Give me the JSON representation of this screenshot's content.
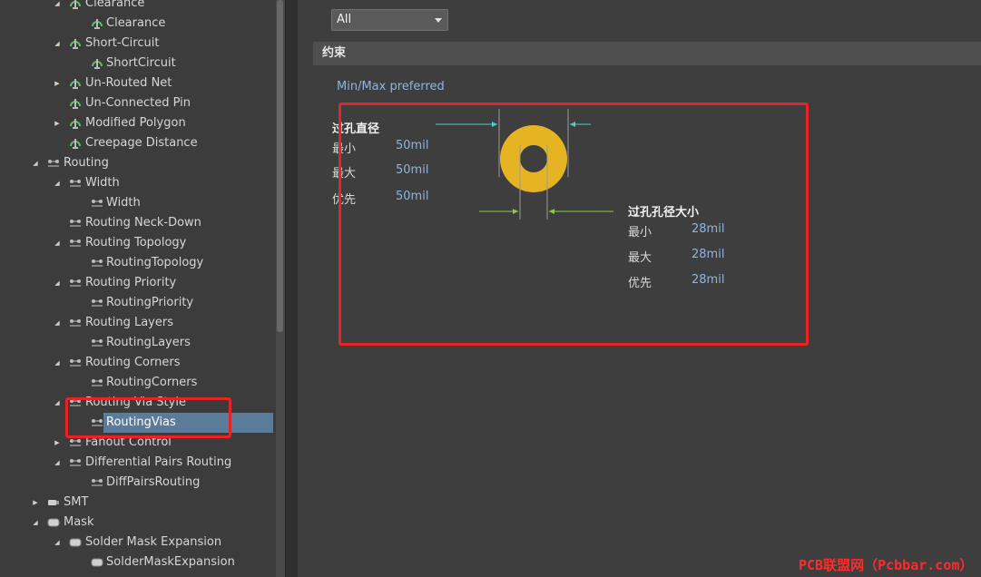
{
  "tree": {
    "items": [
      {
        "label": "Clearance",
        "level": 2,
        "twisty": "expanded",
        "icon": "drc-rule-icon"
      },
      {
        "label": "Clearance",
        "level": 3,
        "twisty": "",
        "icon": "drc-rule-icon"
      },
      {
        "label": "Short-Circuit",
        "level": 2,
        "twisty": "expanded",
        "icon": "drc-rule-icon"
      },
      {
        "label": "ShortCircuit",
        "level": 3,
        "twisty": "",
        "icon": "drc-rule-icon"
      },
      {
        "label": "Un-Routed Net",
        "level": 2,
        "twisty": "collapsed",
        "icon": "drc-rule-icon"
      },
      {
        "label": "Un-Connected Pin",
        "level": 2,
        "twisty": "",
        "icon": "drc-rule-icon"
      },
      {
        "label": "Modified Polygon",
        "level": 2,
        "twisty": "collapsed",
        "icon": "drc-rule-icon"
      },
      {
        "label": "Creepage Distance",
        "level": 2,
        "twisty": "",
        "icon": "drc-rule-icon"
      },
      {
        "label": "Routing",
        "level": 1,
        "twisty": "expanded",
        "icon": "routing-icon"
      },
      {
        "label": "Width",
        "level": 2,
        "twisty": "expanded",
        "icon": "routing-icon"
      },
      {
        "label": "Width",
        "level": 3,
        "twisty": "",
        "icon": "routing-icon"
      },
      {
        "label": "Routing Neck-Down",
        "level": 2,
        "twisty": "",
        "icon": "routing-icon"
      },
      {
        "label": "Routing Topology",
        "level": 2,
        "twisty": "expanded",
        "icon": "routing-icon"
      },
      {
        "label": "RoutingTopology",
        "level": 3,
        "twisty": "",
        "icon": "routing-icon"
      },
      {
        "label": "Routing Priority",
        "level": 2,
        "twisty": "expanded",
        "icon": "routing-icon"
      },
      {
        "label": "RoutingPriority",
        "level": 3,
        "twisty": "",
        "icon": "routing-icon"
      },
      {
        "label": "Routing Layers",
        "level": 2,
        "twisty": "expanded",
        "icon": "routing-icon"
      },
      {
        "label": "RoutingLayers",
        "level": 3,
        "twisty": "",
        "icon": "routing-icon"
      },
      {
        "label": "Routing Corners",
        "level": 2,
        "twisty": "expanded",
        "icon": "routing-icon"
      },
      {
        "label": "RoutingCorners",
        "level": 3,
        "twisty": "",
        "icon": "routing-icon"
      },
      {
        "label": "Routing Via Style",
        "level": 2,
        "twisty": "expanded",
        "icon": "routing-icon"
      },
      {
        "label": "RoutingVias",
        "level": 3,
        "twisty": "",
        "icon": "routing-icon",
        "selected": true
      },
      {
        "label": "Fanout Control",
        "level": 2,
        "twisty": "collapsed",
        "icon": "routing-icon"
      },
      {
        "label": "Differential Pairs Routing",
        "level": 2,
        "twisty": "expanded",
        "icon": "routing-icon"
      },
      {
        "label": "DiffPairsRouting",
        "level": 3,
        "twisty": "",
        "icon": "routing-icon"
      },
      {
        "label": "SMT",
        "level": 1,
        "twisty": "collapsed",
        "icon": "smt-icon"
      },
      {
        "label": "Mask",
        "level": 1,
        "twisty": "expanded",
        "icon": "mask-icon"
      },
      {
        "label": "Solder Mask Expansion",
        "level": 2,
        "twisty": "expanded",
        "icon": "mask-icon"
      },
      {
        "label": "SolderMaskExpansion",
        "level": 3,
        "twisty": "",
        "icon": "mask-icon"
      }
    ]
  },
  "filter": {
    "value": "All"
  },
  "section": {
    "title": "约束"
  },
  "constraints": {
    "mode_link": "Min/Max preferred",
    "via_diameter": {
      "title": "过孔直径",
      "min_label": "最小",
      "min_value": "50mil",
      "max_label": "最大",
      "max_value": "50mil",
      "pref_label": "优先",
      "pref_value": "50mil"
    },
    "hole_size": {
      "title": "过孔孔径大小",
      "min_label": "最小",
      "min_value": "28mil",
      "max_label": "最大",
      "max_value": "28mil",
      "pref_label": "优先",
      "pref_value": "28mil"
    }
  },
  "colors": {
    "via_copper": "#e6b422",
    "via_hole": "#3e3e3e",
    "dim_arrow_cyan": "#56c8c8",
    "dim_arrow_green": "#8cc84a",
    "highlight_red": "#e62424",
    "selection": "#5b7b9a"
  },
  "watermark": "PCB联盟网（Pcbbar.com）"
}
